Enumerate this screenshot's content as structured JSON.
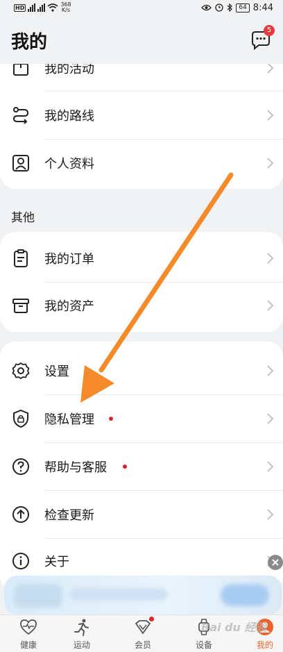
{
  "status_bar": {
    "left_badge": "HD",
    "net_speed_top": "368",
    "net_speed_bottom": "K/s",
    "battery": "64",
    "time": "8:44"
  },
  "header": {
    "title": "我的",
    "message_badge": "5"
  },
  "card1": {
    "items": [
      {
        "label": "我的活动",
        "icon": "activity-icon"
      },
      {
        "label": "我的路线",
        "icon": "route-icon"
      },
      {
        "label": "个人资料",
        "icon": "profile-icon"
      }
    ]
  },
  "section_other": {
    "title": "其他"
  },
  "card2": {
    "items": [
      {
        "label": "我的订单",
        "icon": "order-icon"
      },
      {
        "label": "我的资产",
        "icon": "assets-icon"
      }
    ]
  },
  "card3": {
    "items": [
      {
        "label": "设置",
        "icon": "gear-icon",
        "dot": false
      },
      {
        "label": "隐私管理",
        "icon": "privacy-shield-icon",
        "dot": true
      },
      {
        "label": "帮助与客服",
        "icon": "help-icon",
        "dot": true
      },
      {
        "label": "检查更新",
        "icon": "update-icon",
        "dot": false
      },
      {
        "label": "关于",
        "icon": "info-icon",
        "dot": false
      }
    ]
  },
  "tabbar": {
    "tabs": [
      {
        "label": "健康",
        "icon": "heart-icon",
        "active": false
      },
      {
        "label": "运动",
        "icon": "running-icon",
        "active": false
      },
      {
        "label": "会员",
        "icon": "vip-icon",
        "active": false,
        "dot": true
      },
      {
        "label": "设备",
        "icon": "watch-icon",
        "active": false
      },
      {
        "label": "我的",
        "icon": "avatar-icon",
        "active": true
      }
    ]
  },
  "watermark": "Bai du 经验",
  "colors": {
    "background": "#f1f2f4",
    "card": "#ffffff",
    "accent": "#f0622d",
    "badge": "#e63b3b",
    "annotation_arrow": "#f58a2a"
  }
}
